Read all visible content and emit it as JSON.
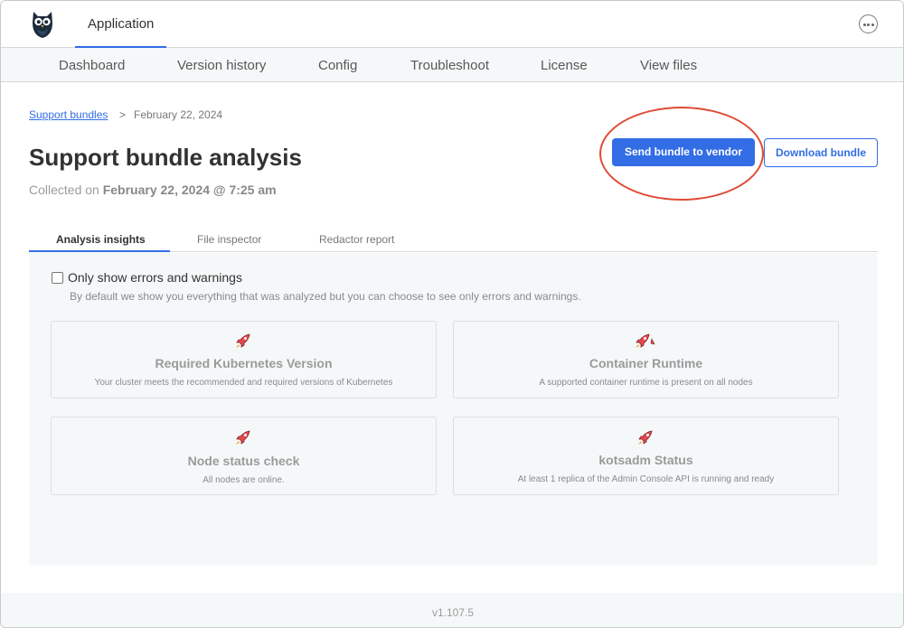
{
  "header": {
    "app_tab": "Application",
    "menu_icon": "more-horizontal-icon",
    "logo_icon": "owl-logo-icon"
  },
  "subnav": [
    "Dashboard",
    "Version history",
    "Config",
    "Troubleshoot",
    "License",
    "View files"
  ],
  "breadcrumb": {
    "link": "Support bundles",
    "separator": ">",
    "current": "February 22, 2024"
  },
  "page": {
    "title": "Support bundle analysis",
    "collected_prefix": "Collected on",
    "collected_value": "February 22, 2024 @ 7:25 am"
  },
  "actions": {
    "send": "Send bundle to vendor",
    "download": "Download bundle",
    "highlight_color": "#e04a35"
  },
  "tabs": [
    "Analysis insights",
    "File inspector",
    "Redactor report"
  ],
  "filter": {
    "label": "Only show errors and warnings",
    "help": "By default we show you everything that was analyzed but you can choose to see only errors and warnings.",
    "checked": false
  },
  "insights": [
    {
      "icon": "rocket-icon",
      "title": "Required Kubernetes Version",
      "desc": "Your cluster meets the recommended and required versions of Kubernetes"
    },
    {
      "icon": "rocket-icon",
      "title": "Container Runtime",
      "desc": "A supported container runtime is present on all nodes"
    },
    {
      "icon": "rocket-icon",
      "title": "Node status check",
      "desc": "All nodes are online."
    },
    {
      "icon": "rocket-icon",
      "title": "kotsadm Status",
      "desc": "At least 1 replica of the Admin Console API is running and ready"
    }
  ],
  "footer": {
    "version": "v1.107.5"
  },
  "colors": {
    "accent": "#326de6",
    "panel_bg": "#f5f8f9",
    "rocket": "#e5484d"
  }
}
